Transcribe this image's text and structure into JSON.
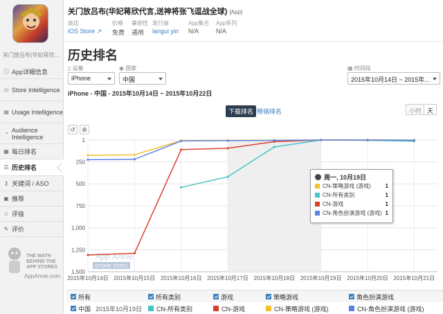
{
  "app": {
    "title": "关门放吕布(华妃蒋欣代言,送神将张飞逗战全球)",
    "tag": "[App]",
    "sidebar_name": "关门放吕布(华妃蒋欣...",
    "meta": [
      {
        "key": "商店",
        "value": "iOS Store ↗"
      },
      {
        "key": "价格",
        "value": "免费"
      },
      {
        "key": "兼容性",
        "value": "通用"
      },
      {
        "key": "发行商",
        "value": "langui yin"
      },
      {
        "key": "App集合",
        "value": "N/A"
      },
      {
        "key": "App系列",
        "value": "N/A"
      }
    ]
  },
  "sidebar": {
    "items": [
      {
        "label": "App详细信息",
        "icon": "info-icon"
      },
      {
        "label": "Store Intelligence",
        "icon": "store-icon"
      },
      {
        "label": "Usage Intelligence",
        "icon": "usage-icon"
      },
      {
        "label": "Audience Intelligence",
        "icon": "audience-icon"
      },
      {
        "label": "每日排名",
        "icon": "calendar-icon"
      },
      {
        "label": "历史排名",
        "icon": "history-icon"
      },
      {
        "label": "关键词 / ASO",
        "icon": "key-icon"
      },
      {
        "label": "推荐",
        "icon": "featured-icon"
      },
      {
        "label": "评级",
        "icon": "star-icon"
      },
      {
        "label": "评价",
        "icon": "comment-icon"
      }
    ],
    "logo_text": "THE MATH BEHIND THE APP STORES",
    "logo_site": "AppAnnie.com"
  },
  "page": {
    "title": "历史排名",
    "device_label": "设备",
    "device_value": "iPhone",
    "country_label": "国家",
    "country_value": "中国",
    "period_label": "时间段",
    "period_value": "2015年10月14日 ~ 2015年...",
    "subtitle": "iPhone - 中国 - 2015年10月14日 ~ 2015年10月22日",
    "tab_download": "下载排名",
    "tab_grossing": "畅销排名",
    "unit_hour": "小时",
    "unit_day": "天",
    "watermark": "App Annie",
    "watermark_sub": "STORE STATS"
  },
  "colors": {
    "all": "#47c3c6",
    "games": "#d9402a",
    "strategy": "#f5c02c",
    "rpg": "#5b82e6"
  },
  "chart_data": {
    "type": "line",
    "x": [
      "2015年10月14日",
      "2015年10月15日",
      "2015年10月16日",
      "2015年10月17日",
      "2015年10月18日",
      "2015年10月19日",
      "2015年10月20日",
      "2015年10月21日"
    ],
    "y_ticks": [
      "1",
      "250",
      "500",
      "750",
      "1,000",
      "1,250",
      "1,500"
    ],
    "ylim": [
      1,
      1500
    ],
    "y_reversed": true,
    "series": [
      {
        "name": "CN-所有类别",
        "color": "#47c3c6",
        "values": [
          null,
          null,
          540,
          420,
          80,
          1,
          5,
          15
        ]
      },
      {
        "name": "CN-游戏",
        "color": "#d9402a",
        "values": [
          1310,
          1290,
          110,
          95,
          20,
          1,
          1,
          5
        ]
      },
      {
        "name": "CN-策略游戏 (游戏)",
        "color": "#f5c02c",
        "values": [
          175,
          170,
          8,
          5,
          3,
          1,
          1,
          2
        ]
      },
      {
        "name": "CN-角色扮演游戏 (游戏)",
        "color": "#5b82e6",
        "values": [
          225,
          220,
          12,
          8,
          5,
          1,
          1,
          3
        ]
      }
    ]
  },
  "tooltip": {
    "title": "周一, 10月19日",
    "rows": [
      {
        "label": "CN-策略游戏 (游戏)",
        "value": "1"
      },
      {
        "label": "CN-所有类别",
        "value": "1"
      },
      {
        "label": "CN-游戏",
        "value": "1"
      },
      {
        "label": "CN-角色扮演游戏 (游戏)",
        "value": "1"
      }
    ]
  },
  "legend": {
    "headers": [
      "所有",
      "所有类别",
      "游戏",
      "策略游戏",
      "角色扮演游戏"
    ],
    "row_country": "中国",
    "row_date": "2015年10月19日",
    "row_items": [
      "CN-所有类别",
      "CN-游戏",
      "CN-策略游戏 (游戏)",
      "CN-角色扮演游戏 (游戏)"
    ]
  }
}
